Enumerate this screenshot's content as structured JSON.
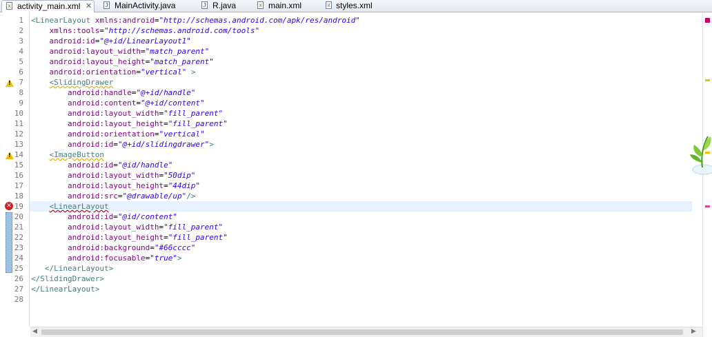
{
  "tabs": [
    {
      "label": "activity_main.xml",
      "icon": "xml-file-icon",
      "active": true
    },
    {
      "label": "MainActivity.java",
      "icon": "java-file-icon",
      "active": false
    },
    {
      "label": "R.java",
      "icon": "java-file-icon",
      "active": false
    },
    {
      "label": "main.xml",
      "icon": "xml-file-icon",
      "active": false
    },
    {
      "label": "styles.xml",
      "icon": "xml-file-icon",
      "active": false
    }
  ],
  "tab_close_glyph": "✕",
  "editor": {
    "line_numbers": [
      "1",
      "2",
      "3",
      "4",
      "5",
      "6",
      "7",
      "8",
      "9",
      "10",
      "11",
      "12",
      "13",
      "14",
      "15",
      "16",
      "17",
      "18",
      "19",
      "20",
      "21",
      "22",
      "23",
      "24",
      "25",
      "26",
      "27",
      "28"
    ],
    "lines": [
      "<LinearLayout xmlns:android=\"http://schemas.android.com/apk/res/android\"",
      "    xmlns:tools=\"http://schemas.android.com/tools\"",
      "    android:id=\"@+id/LinearLayout1\"",
      "    android:layout_width=\"match_parent\"",
      "    android:layout_height=\"match_parent\"",
      "    android:orientation=\"vertical\" >",
      "    <SlidingDrawer",
      "        android:handle=\"@+id/handle\"",
      "        android:content=\"@+id/content\"",
      "        android:layout_width=\"fill_parent\"",
      "        android:layout_height=\"fill_parent\"",
      "        android:orientation=\"vertical\"",
      "        android:id=\"@+id/slidingdrawer\">",
      "    <ImageButton",
      "        android:id=\"@id/handle\"",
      "        android:layout_width=\"50dip\"",
      "        android:layout_height=\"44dip\"",
      "        android:src=\"@drawable/up\"/>",
      "    <LinearLayout",
      "        android:id=\"@id/content\"",
      "        android:layout_width=\"fill_parent\"",
      "        android:layout_height=\"fill_parent\"",
      "        android:background=\"#66cccc\"",
      "        android:focusable=\"true\">",
      "   </LinearLayout>",
      "</SlidingDrawer>",
      "</LinearLayout>",
      ""
    ],
    "warning_lines": [
      "7",
      "14"
    ],
    "error_lines": [
      "19"
    ],
    "current_line": "19"
  },
  "colors": {
    "tag": "#3f7f7f",
    "attribute": "#7f007f",
    "value": "#2a00ff",
    "current_line_bg": "#e8f2fe",
    "warning": "#f2c200",
    "error": "#d02020"
  }
}
